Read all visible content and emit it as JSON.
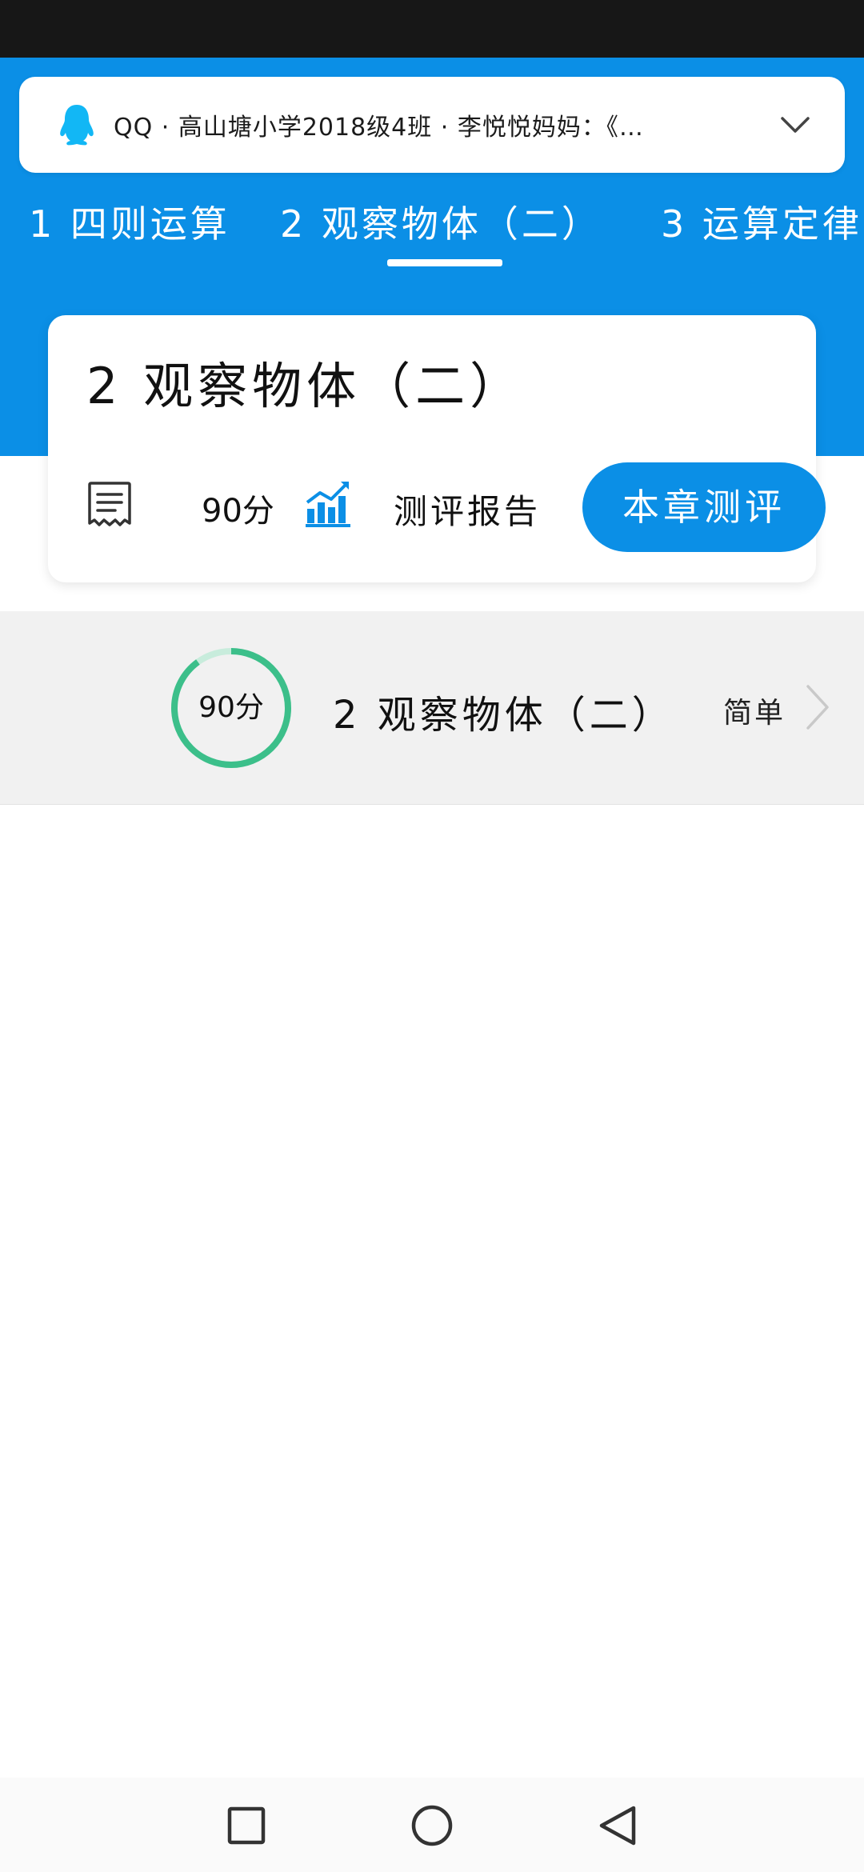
{
  "share_bar": {
    "text": "QQ · 高山塘小学2018级4班 · 李悦悦妈妈：《…",
    "app_icon": "qq-penguin-icon",
    "expand_icon": "chevron-down-icon"
  },
  "tabs": [
    {
      "label": "1 四则运算"
    },
    {
      "label": "2 观察物体（二）"
    },
    {
      "label": "3 运算定律"
    }
  ],
  "active_tab_index": 1,
  "chapter_card": {
    "title": "2 观察物体（二）",
    "score": "90分",
    "report_label": "测评报告",
    "test_button_label": "本章测评"
  },
  "sections": [
    {
      "score_label": "90分",
      "score_fraction": 0.9,
      "title": "2 观察物体（二）",
      "difficulty": "简单"
    }
  ],
  "colors": {
    "primary": "#0b8fe6",
    "progress_green": "#3cbf8a",
    "progress_track": "#c8ecdc",
    "status_bar": "#171717",
    "qq_blue": "#12b7f5"
  },
  "navigation": {
    "recent_icon": "square-recents-icon",
    "home_icon": "circle-home-icon",
    "back_icon": "triangle-back-icon"
  }
}
